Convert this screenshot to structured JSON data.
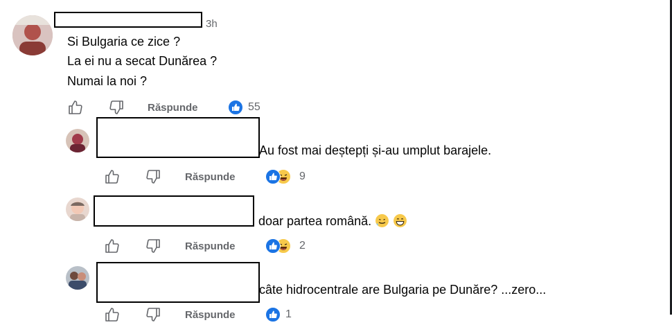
{
  "comments": [
    {
      "lines": [
        "Si Bulgaria ce zice ?",
        "La ei nu a secat Dunărea ?",
        "Numai la noi ?"
      ],
      "timestamp": "3h",
      "reply_label": "Răspunde",
      "reaction_count": "55"
    },
    {
      "text": "Au fost mai deștepți și-au umplut barajele.",
      "reply_label": "Răspunde",
      "reaction_count": "9"
    },
    {
      "text": "doar partea română.",
      "reply_label": "Răspunde",
      "reaction_count": "2"
    },
    {
      "text": "câte hidrocentrale are Bulgaria pe Dunăre? ...zero...",
      "reply_label": "Răspunde",
      "reaction_count": "1"
    }
  ],
  "icons": {
    "like": "thumbs-up-outline-icon",
    "dislike": "thumbs-down-outline-icon",
    "reaction_like": "like-reaction-icon",
    "reaction_haha": "haha-reaction-icon",
    "emoji_sweat": "sweat-smile-emoji",
    "emoji_grin": "grin-emoji"
  },
  "colors": {
    "accent": "#1b74e4",
    "muted": "#65676b",
    "text": "#050505"
  }
}
